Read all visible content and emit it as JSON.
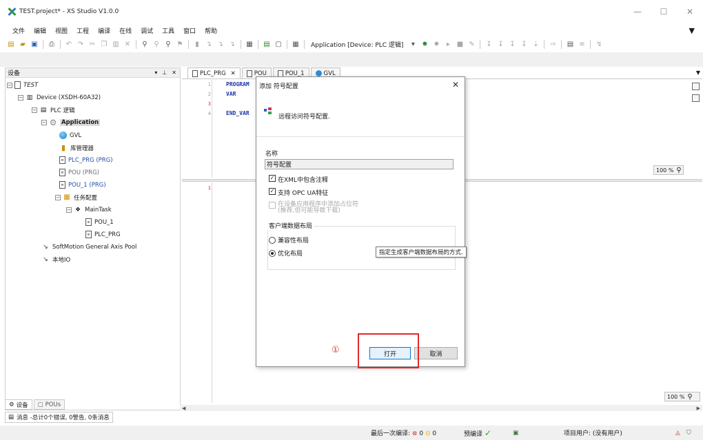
{
  "window": {
    "title": "TEST.project* - XS Studio V1.0.0"
  },
  "menu": [
    "文件",
    "编辑",
    "视图",
    "工程",
    "编译",
    "在线",
    "调试",
    "工具",
    "窗口",
    "帮助"
  ],
  "toolbar": {
    "application_combo": "Application [Device: PLC 逻辑]"
  },
  "devices_pane": {
    "title": "设备",
    "tree": [
      {
        "label": "TEST",
        "icon": "project-icon"
      },
      {
        "label": "Device (XSDH-60A32)",
        "icon": "device-icon"
      },
      {
        "label": "PLC 逻辑",
        "icon": "plc-logic-icon"
      },
      {
        "label": "Application",
        "icon": "gear-icon"
      },
      {
        "label": "GVL",
        "icon": "globe-icon"
      },
      {
        "label": "库管理器",
        "icon": "library-icon"
      },
      {
        "label": "PLC_PRG (PRG)",
        "icon": "page-icon"
      },
      {
        "label": "POU (PRG)",
        "icon": "page-icon"
      },
      {
        "label": "POU_1 (PRG)",
        "icon": "page-icon"
      },
      {
        "label": "任务配置",
        "icon": "task-config-icon"
      },
      {
        "label": "MainTask",
        "icon": "task-icon"
      },
      {
        "label": "POU_1",
        "icon": "page-icon"
      },
      {
        "label": "PLC_PRG",
        "icon": "page-icon"
      },
      {
        "label": "SoftMotion General Axis Pool",
        "icon": "axis-icon"
      },
      {
        "label": "本地IO",
        "icon": "io-icon"
      }
    ],
    "tabs": [
      "设备",
      "POUs"
    ],
    "messages": "消息 -总计0个错误, 0警告, 0条消息"
  },
  "editor": {
    "tabs": [
      "PLC_PRG",
      "POU",
      "POU_1",
      "GVL"
    ],
    "decl_lines": [
      {
        "n": "1",
        "code": "PROGRAM"
      },
      {
        "n": "2",
        "code": "VAR"
      },
      {
        "n": "3",
        "code": ""
      },
      {
        "n": "4",
        "code": "END_VAR"
      }
    ],
    "impl_line": "1",
    "zoom_top": "100 %",
    "zoom_bottom": "100 %"
  },
  "dialog": {
    "title": "添加 符号配置",
    "header_text": "远程访问符号配置.",
    "name_label": "名称",
    "name_value": "符号配置",
    "checkbox_xml_comments": {
      "label": "在XML中包含注释",
      "checked": true
    },
    "checkbox_opc_ua": {
      "label": "支持 OPC UA特征",
      "checked": true
    },
    "checkbox_placeholder": {
      "label_line1": "在设备应用程序中添加占位符",
      "label_line2": "(推荐,但可能导致下载)",
      "checked": false,
      "enabled": false
    },
    "group_title": "客户端数据布局",
    "radio_compatible": {
      "label": "兼容性布局",
      "checked": false
    },
    "radio_optimized": {
      "label": "优化布局",
      "checked": true
    },
    "tooltip": "指定生成客户端数据布局的方式.",
    "step_marker": "①",
    "open_button": "打开",
    "cancel_button": "取消"
  },
  "status": {
    "last_compile": "最后一次编译:",
    "errors": "0",
    "warnings": "0",
    "precompile": "预编译",
    "project_user": "项目用户: (没有用户)"
  }
}
